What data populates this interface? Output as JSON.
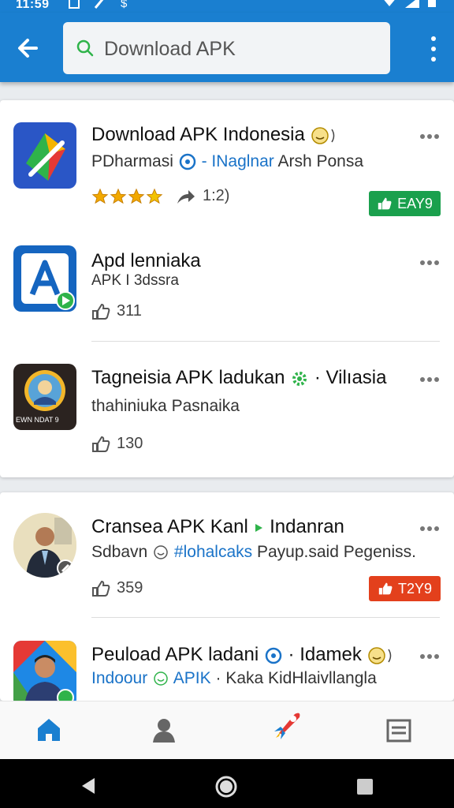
{
  "status_bar": {
    "time": "11:59"
  },
  "search": {
    "value": "Download APK"
  },
  "apps": [
    {
      "title": "Download APK Indonesia",
      "sub_a": "PDharmasi",
      "sub_sep": "-",
      "sub_b": "INaglnar",
      "sub_c": "Arsh Ponsa",
      "rating_text": "1:2)",
      "stars": 4
    },
    {
      "title": "Apd lenniaka",
      "sub": "APK I 3dssra",
      "likes": "311"
    },
    {
      "title": "Tagneisia APK ladukan",
      "title_sep": "·",
      "title_b": "Vilıasia",
      "sub": "thahiniuka Pasnaika",
      "icon_text": "EWN NDAT 9",
      "likes": "130",
      "badge": "EAY9"
    },
    {
      "title": "Cransea APK Kanl",
      "title_b": "Indanran",
      "sub_a": "Sdbavn",
      "sub_b": "#lohalcaks",
      "sub_c": "Payup.said Pegeniss.",
      "likes": "359",
      "badge": "T2Y9"
    },
    {
      "title": "Peuload APK ladani",
      "title_sep": "·",
      "title_b": "Idamek",
      "sub_a": "Indoour",
      "sub_b": "APIK",
      "sub_sep": "·",
      "sub_c": "Kaka KidHlaivllangla"
    }
  ],
  "colors": {
    "appbar": "#1a7fd0",
    "accent_green": "#1aa04d",
    "accent_red": "#e3401c",
    "link_blue": "#1a73c8"
  },
  "icons": [
    "back-arrow-icon",
    "search-icon",
    "more-vert-icon",
    "more-horiz-icon",
    "thumbs-up-icon",
    "home-icon",
    "person-icon",
    "rocket-icon",
    "list-icon"
  ]
}
